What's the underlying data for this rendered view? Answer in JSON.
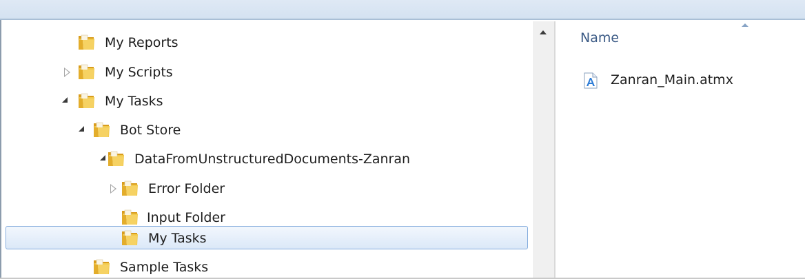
{
  "tree": {
    "items": [
      {
        "label": "My Reports",
        "expander": "none"
      },
      {
        "label": "My Scripts",
        "expander": "collapsed"
      },
      {
        "label": "My Tasks",
        "expander": "expanded"
      },
      {
        "label": "Bot Store",
        "expander": "expanded"
      },
      {
        "label": "DataFromUnstructuredDocuments-Zanran",
        "expander": "expanded"
      },
      {
        "label": "Error Folder",
        "expander": "collapsed"
      },
      {
        "label": "Input Folder",
        "expander": "none"
      },
      {
        "label": "My Tasks",
        "expander": "none",
        "selected": true
      },
      {
        "label": "Sample Tasks",
        "expander": "none"
      }
    ]
  },
  "file_list": {
    "column_header": "Name",
    "sort_direction": "ascending",
    "files": [
      {
        "name": "Zanran_Main.atmx",
        "icon": "atmx-file-icon"
      }
    ]
  },
  "colors": {
    "folder": "#e8b830",
    "selection_border": "#84acdd",
    "header_text": "#3b5a85"
  }
}
